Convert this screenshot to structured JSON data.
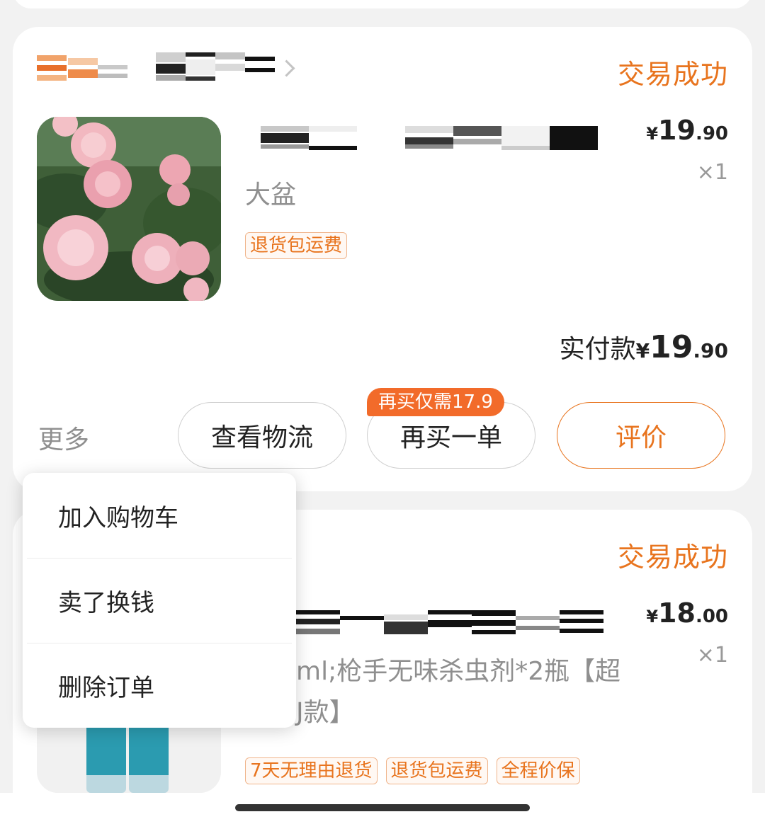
{
  "orders": [
    {
      "status": "交易成功",
      "item": {
        "sku": "大盆",
        "tags": [
          "退货包运费"
        ],
        "price": {
          "currency": "¥",
          "int": "19",
          "dec": ".90"
        },
        "qty": "×1"
      },
      "paid": {
        "label": "实付款",
        "currency": "¥",
        "int": "19",
        "dec": ".90"
      },
      "actions": {
        "more": "更多",
        "logistics": "查看物流",
        "rebuy": "再买一单",
        "rebuy_promo": "再买仅需17.9",
        "review": "评价"
      }
    },
    {
      "status": "交易成功",
      "item": {
        "sku": "ml;枪手无味杀虫剂*2瓶【超",
        "sku_line2": "J款】",
        "tags": [
          "7天无理由退货",
          "退货包运费",
          "全程价保"
        ],
        "price": {
          "currency": "¥",
          "int": "18",
          "dec": ".00"
        },
        "qty": "×1"
      }
    }
  ],
  "more_menu": {
    "items": [
      "加入购物车",
      "卖了换钱",
      "删除订单"
    ]
  },
  "colors": {
    "accent": "#e8741e",
    "promo": "#f26b2a"
  }
}
